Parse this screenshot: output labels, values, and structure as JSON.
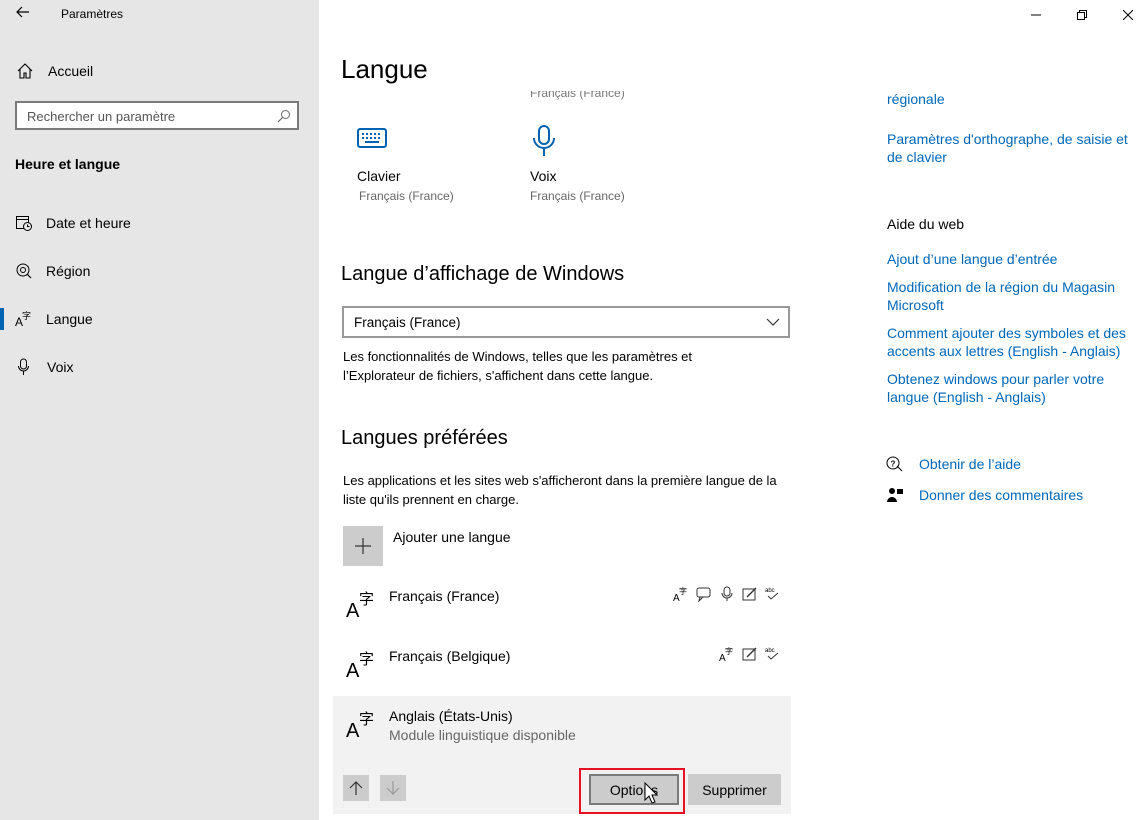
{
  "app": {
    "title": "Paramètres"
  },
  "sidebar": {
    "home_label": "Accueil",
    "search_placeholder": "Rechercher un paramètre",
    "section_title": "Heure et langue",
    "items": [
      {
        "label": "Date et heure",
        "icon": "calendar-clock-icon",
        "active": false
      },
      {
        "label": "Région",
        "icon": "globe-icon",
        "active": false
      },
      {
        "label": "Langue",
        "icon": "language-icon",
        "active": true
      },
      {
        "label": "Voix",
        "icon": "microphone-icon",
        "active": false
      }
    ]
  },
  "main": {
    "title": "Langue",
    "cut_text": "Français (France)",
    "tiles": [
      {
        "title": "Clavier",
        "subtitle": "Français (France)",
        "icon": "keyboard-icon"
      },
      {
        "title": "Voix",
        "subtitle": "Français (France)",
        "icon": "microphone-icon"
      }
    ],
    "display_language": {
      "heading": "Langue d’affichage de Windows",
      "selected": "Français (France)",
      "description": "Les fonctionnalités de Windows, telles que les paramètres et l’Explorateur de fichiers, s'affichent dans cette langue."
    },
    "preferred": {
      "heading": "Langues préférées",
      "description": "Les applications et les sites web s'afficheront dans la première langue de la liste qu'ils prennent en charge.",
      "add_label": "Ajouter une langue",
      "languages": [
        {
          "name": "Français (France)",
          "sub": "",
          "features": [
            "display-language-icon",
            "speech-bubble-icon",
            "microphone-icon",
            "handwriting-icon",
            "spellcheck-icon"
          ]
        },
        {
          "name": "Français (Belgique)",
          "sub": "",
          "features": [
            "display-language-icon",
            "handwriting-icon",
            "spellcheck-icon"
          ]
        },
        {
          "name": "Anglais (États-Unis)",
          "sub": "Module linguistique disponible",
          "features": []
        }
      ],
      "options_label": "Options",
      "remove_label": "Supprimer"
    }
  },
  "right_panel": {
    "related_links": [
      "régionale",
      "Paramètres d'orthographe, de saisie et de clavier"
    ],
    "web_help_title": "Aide du web",
    "web_help_links": [
      "Ajout d’une langue d’entrée",
      "Modification de la région du Magasin Microsoft",
      "Comment ajouter des symboles et des accents aux lettres (English - Anglais)",
      "Obtenez windows pour parler votre langue (English - Anglais)"
    ],
    "help_label": "Obtenir de l’aide",
    "feedback_label": "Donner des commentaires"
  },
  "colors": {
    "accent": "#0063b1",
    "link": "#0067b8",
    "sidebar_bg": "#e6e6e6",
    "highlight": "#e81123"
  }
}
